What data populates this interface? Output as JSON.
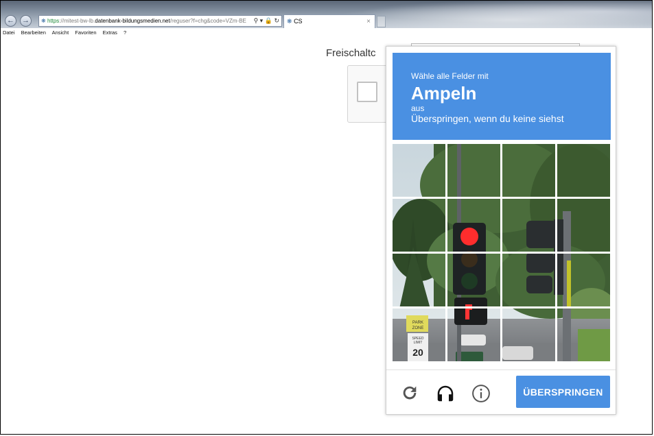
{
  "browser": {
    "url_scheme": "https",
    "url_prefix": "://mitest-bw-lb.",
    "url_host": "datenbank-bildungsmedien.net",
    "url_rest": "/reguser?f=chg&code=VZm-BE",
    "tab_title": "CS",
    "tab_close": "×",
    "menu": [
      "Datei",
      "Bearbeiten",
      "Ansicht",
      "Favoriten",
      "Extras",
      "?"
    ]
  },
  "page": {
    "label": "Freischaltc"
  },
  "challenge": {
    "instruction": "Wähle alle Felder mit",
    "target": "Ampeln",
    "from": "aus",
    "hint": "Überspringen, wenn du keine siehst",
    "skip_label": "ÜBERSPRINGEN",
    "icons": [
      "reload-icon",
      "headphones-icon",
      "info-icon"
    ],
    "grid_rows": 4,
    "grid_cols": 4,
    "colors": {
      "header": "#4a90e2",
      "button": "#4a90e2"
    }
  }
}
